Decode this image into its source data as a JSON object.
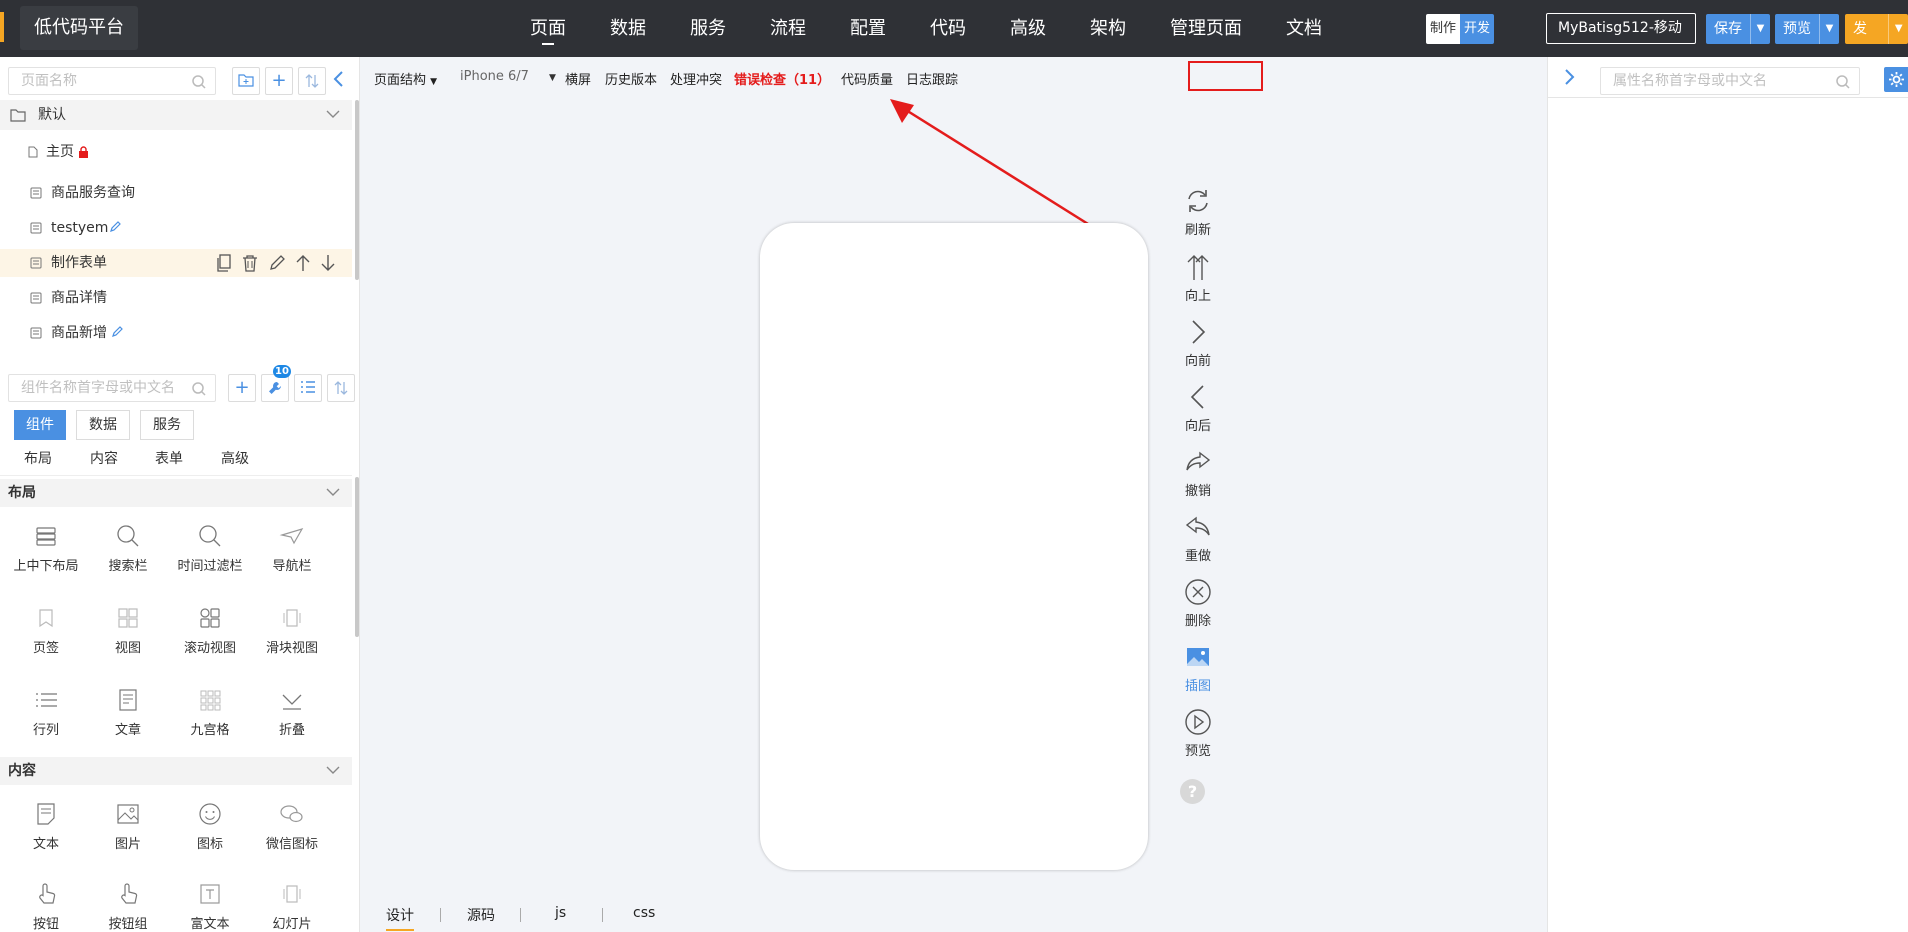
{
  "app": {
    "logo": "低代码平台"
  },
  "topnav": {
    "items": [
      "页面",
      "数据",
      "服务",
      "流程",
      "配置",
      "代码",
      "高级",
      "架构",
      "管理页面",
      "文档"
    ],
    "active": "页面"
  },
  "mode_toggle": {
    "make": "制作",
    "dev": "开发"
  },
  "project": {
    "name": "MyBatisg512-移动"
  },
  "actions": {
    "save": "保存",
    "preview": "预览",
    "publish": "发布"
  },
  "left": {
    "page_search_placeholder": "页面名称",
    "group": "默认",
    "pages": [
      {
        "label": "主页",
        "extra": "lock"
      },
      {
        "label": "商品服务查询",
        "extra": ""
      },
      {
        "label": "testyem",
        "extra": "pencil"
      },
      {
        "label": "制作表单",
        "extra": "actions"
      },
      {
        "label": "商品详情",
        "extra": ""
      },
      {
        "label": "商品新增",
        "extra": "pencil"
      }
    ],
    "component_search_placeholder": "组件名称首字母或中文名",
    "tool_badge": "10",
    "tabs": [
      "组件",
      "数据",
      "服务"
    ],
    "subtabs": [
      "布局",
      "内容",
      "表单",
      "高级"
    ],
    "sections": {
      "layout": {
        "title": "布局",
        "items": [
          "上中下布局",
          "搜索栏",
          "时间过滤栏",
          "导航栏",
          "页签",
          "视图",
          "滚动视图",
          "滑块视图",
          "行列",
          "文章",
          "九宫格",
          "折叠"
        ]
      },
      "content": {
        "title": "内容",
        "items": [
          "文本",
          "图片",
          "图标",
          "微信图标",
          "按钮",
          "按钮组",
          "富文本",
          "幻灯片"
        ]
      }
    }
  },
  "center": {
    "toolbar": {
      "page_structure": "页面结构",
      "device": "iPhone 6/7",
      "landscape": "横屏",
      "history": "历史版本",
      "conflict": "处理冲突",
      "error_check": "错误检查（11）",
      "code_quality": "代码质量",
      "log_trace": "日志跟踪"
    },
    "vertical_tools": [
      "刷新",
      "向上",
      "向前",
      "向后",
      "撤销",
      "重做",
      "删除",
      "插图",
      "预览"
    ],
    "help": "?",
    "bottom_tabs": [
      "设计",
      "源码",
      "js",
      "css"
    ]
  },
  "right": {
    "search_placeholder": "属性名称首字母或中文名"
  },
  "colors": {
    "accent": "#4a90e2",
    "publish": "#f5a623",
    "error": "#e41c1c",
    "topbar": "#2f3136"
  }
}
